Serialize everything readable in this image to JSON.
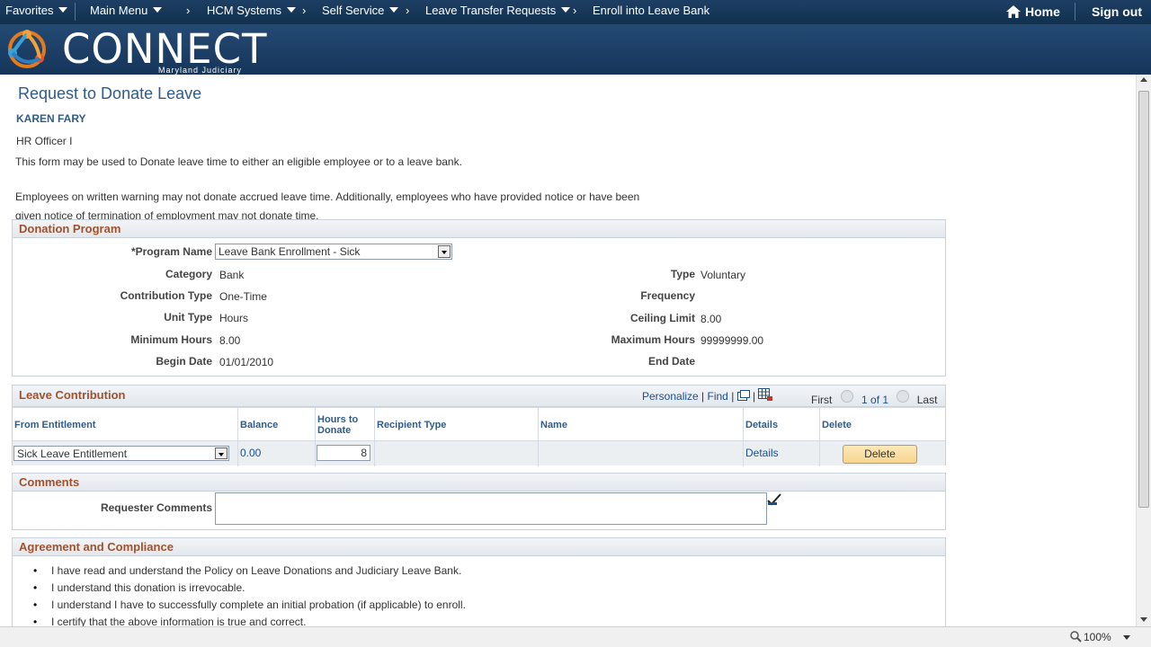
{
  "nav": {
    "favorites": "Favorites",
    "main_menu": "Main Menu",
    "hcm": "HCM Systems",
    "self_service": "Self Service",
    "leave_transfer": "Leave Transfer Requests",
    "current": "Enroll into Leave Bank",
    "home": "Home",
    "signout": "Sign out"
  },
  "banner": {
    "logo": "CONNECT",
    "sub": "Maryland Judiciary"
  },
  "page": {
    "title": "Request to Donate Leave",
    "employee_name": "KAREN FARY",
    "employee_title": "HR Officer I",
    "info1": "This form may be used to Donate leave time to either an eligible employee or to a leave bank.",
    "info2": "Employees on written warning may not donate accrued leave time. Additionally, employees who have provided notice or have been given notice of termination of employment may not donate time."
  },
  "donation": {
    "header": "Donation Program",
    "program_label": "*Program Name",
    "program_value": "Leave Bank Enrollment - Sick",
    "category_label": "Category",
    "category_value": "Bank",
    "contribution_label": "Contribution Type",
    "contribution_value": "One-Time",
    "unit_label": "Unit Type",
    "unit_value": "Hours",
    "min_label": "Minimum Hours",
    "min_value": "8.00",
    "begin_label": "Begin Date",
    "begin_value": "01/01/2010",
    "type_label": "Type",
    "type_value": "Voluntary",
    "frequency_label": "Frequency",
    "frequency_value": "",
    "ceiling_label": "Ceiling Limit",
    "ceiling_value": "8.00",
    "max_label": "Maximum Hours",
    "max_value": "99999999.00",
    "end_label": "End Date",
    "end_value": ""
  },
  "contribution": {
    "header": "Leave Contribution",
    "toolbar": {
      "personalize": "Personalize",
      "find": "Find",
      "first": "First",
      "count": "1 of 1",
      "last": "Last"
    },
    "columns": [
      "From Entitlement",
      "Balance",
      "Hours to Donate",
      "Recipient Type",
      "Name",
      "Details",
      "Delete"
    ],
    "row": {
      "entitlement": "Sick Leave Entitlement",
      "balance": "0.00",
      "hours": "8",
      "recipient_type": "",
      "name": "",
      "details": "Details",
      "delete": "Delete"
    }
  },
  "comments": {
    "header": "Comments",
    "label": "Requester Comments",
    "value": ""
  },
  "agreement": {
    "header": "Agreement and Compliance",
    "items": [
      "I have read and understand the Policy on Leave Donations and Judiciary Leave Bank.",
      "I understand this donation is irrevocable.",
      "I understand I have to successfully complete an initial probation (if applicable) to enroll.",
      "I certify that the above information is true and correct."
    ]
  },
  "status": {
    "zoom": "100%"
  }
}
